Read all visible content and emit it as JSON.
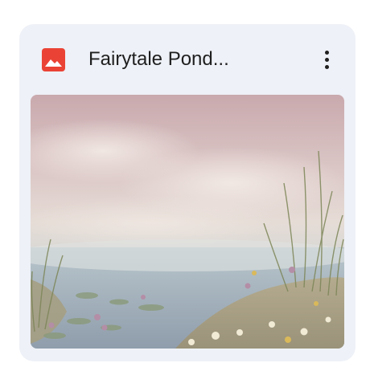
{
  "card": {
    "title": "Fairytale Pond...",
    "file_type_icon": "image-icon",
    "menu_icon": "more-vert-icon"
  },
  "colors": {
    "card_background": "#eef1f7",
    "icon_red": "#ea4335",
    "text": "#1f1f1f"
  }
}
